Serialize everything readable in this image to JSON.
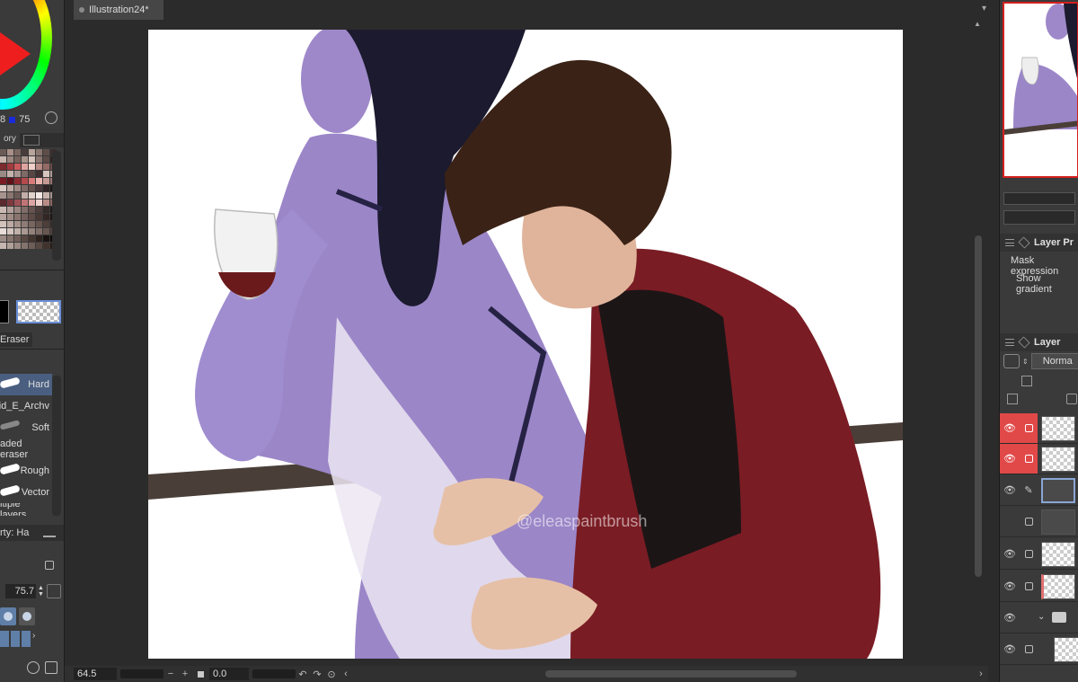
{
  "left_panel": {
    "color_values": {
      "v1": "8",
      "v2": "75"
    },
    "palette_tab": "ory",
    "palette_colors": [
      "#6b5a56",
      "#a89088",
      "#7a6660",
      "#4a3c3c",
      "#b7a49a",
      "#8c7670",
      "#5e4e4a",
      "#3a2e2e",
      "#c9b6ae",
      "#9c8680",
      "#76625c",
      "#a7958c",
      "#d4c4bc",
      "#8a7670",
      "#5c4a46",
      "#2e2424",
      "#7c2a2e",
      "#a33a3e",
      "#c95a5c",
      "#e0a4a0",
      "#f0d0c8",
      "#b88a84",
      "#946a66",
      "#6a4a46",
      "#9a8a86",
      "#c4b2ac",
      "#a89490",
      "#7e6a66",
      "#584644",
      "#3e3030",
      "#d6c6c0",
      "#b09c96",
      "#7a1c24",
      "#5e121a",
      "#8e2a30",
      "#b44a4c",
      "#d87c7a",
      "#ebb4ae",
      "#c49a94",
      "#9c7672",
      "#d8c8c2",
      "#bca8a2",
      "#9e8882",
      "#806a66",
      "#64504c",
      "#48383a",
      "#302426",
      "#1c1616",
      "#a8948e",
      "#8a7670",
      "#6c5a56",
      "#c2aea8",
      "#e2d2cc",
      "#f4e8e4",
      "#c8b4ae",
      "#a6928c",
      "#5a2a2e",
      "#7c3a3e",
      "#9e5256",
      "#c07476",
      "#dca4a2",
      "#eed0cc",
      "#b88c88",
      "#8e6662",
      "#ccbab4",
      "#b4a09a",
      "#9a8680",
      "#806c68",
      "#66524e",
      "#4c3c3a",
      "#342a28",
      "#201a1a",
      "#b6a29c",
      "#a08a84",
      "#8a746e",
      "#745e5a",
      "#5e4a46",
      "#483834",
      "#322624",
      "#1e1614",
      "#d2c2bc",
      "#bcaaa4",
      "#a6928c",
      "#907c76",
      "#7a6660",
      "#64524c",
      "#4e3e3a",
      "#382c28",
      "#e8dcd8",
      "#d4c6c0",
      "#c0b0aa",
      "#aa9892",
      "#94827c",
      "#7e6c66",
      "#685650",
      "#52403c",
      "#9c8a84",
      "#86746e",
      "#705e58",
      "#5a4842",
      "#44342e",
      "#2e221e",
      "#1a1210",
      "#0c0806",
      "#c6b6b0",
      "#b0a09a",
      "#9a8a84",
      "#84746e",
      "#6e5e58",
      "#584842",
      "#42322c",
      "#2c1e18"
    ],
    "eraser_tab": "Eraser",
    "eraser_items": [
      {
        "label": "Hard",
        "selected": true
      },
      {
        "label": "id_E_Archv",
        "selected": false
      },
      {
        "label": "Soft",
        "selected": false
      },
      {
        "label": "aded eraser",
        "selected": false
      },
      {
        "label": "Rough",
        "selected": false
      },
      {
        "label": "Vector",
        "selected": false
      },
      {
        "label": "ltiple layers",
        "selected": false
      }
    ],
    "property_label": "rty: Ha",
    "brush_size": "75.7"
  },
  "canvas": {
    "doc_tab_title": "Illustration24*",
    "watermark": "@eleaspaintbrush"
  },
  "status": {
    "zoom": "64.5",
    "rotation": "0.0"
  },
  "right_panel": {
    "layer_property_title": "Layer Pr",
    "mask_expression": "Mask expression",
    "show_gradient": "Show gradient",
    "layer_title": "Layer",
    "blend_mode": "Norma",
    "accent_red": "#e14848",
    "selection_blue": "#8aa6d4"
  }
}
